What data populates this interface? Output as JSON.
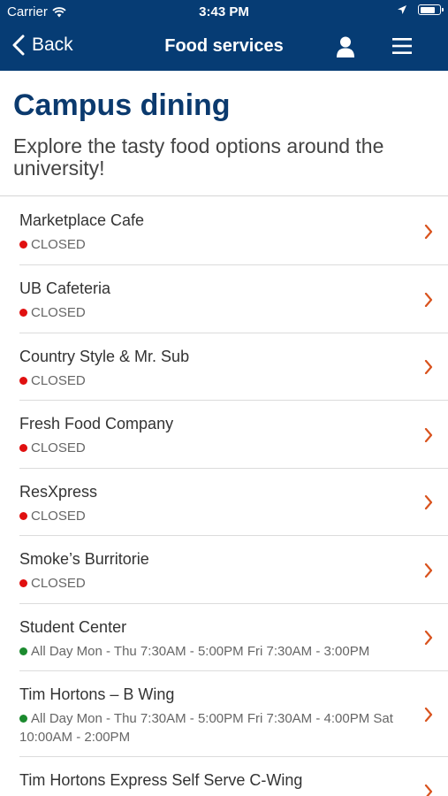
{
  "status_bar": {
    "carrier": "Carrier",
    "time": "3:43 PM"
  },
  "nav": {
    "back_label": "Back",
    "title": "Food services"
  },
  "header": {
    "title": "Campus dining",
    "subtitle": "Explore the tasty food options around the university!"
  },
  "colors": {
    "nav_bg": "#063c74",
    "title": "#0b3a6e",
    "chevron": "#d9531e",
    "closed_dot": "#e01010",
    "open_dot": "#1b8a2e"
  },
  "locations": [
    {
      "name": "Marketplace Cafe",
      "state": "closed",
      "status": "CLOSED"
    },
    {
      "name": "UB Cafeteria",
      "state": "closed",
      "status": "CLOSED"
    },
    {
      "name": "Country Style & Mr. Sub",
      "state": "closed",
      "status": "CLOSED"
    },
    {
      "name": "Fresh Food Company",
      "state": "closed",
      "status": "CLOSED"
    },
    {
      "name": "ResXpress",
      "state": "closed",
      "status": "CLOSED"
    },
    {
      "name": "Smoke’s Burritorie",
      "state": "closed",
      "status": "CLOSED"
    },
    {
      "name": "Student Center",
      "state": "open",
      "status": "All Day Mon - Thu 7:30AM - 5:00PM Fri 7:30AM - 3:00PM"
    },
    {
      "name": "Tim Hortons – B Wing",
      "state": "open",
      "status": "All Day Mon - Thu 7:30AM - 5:00PM Fri 7:30AM - 4:00PM Sat 10:00AM - 2:00PM"
    },
    {
      "name": "Tim Hortons Express Self Serve C-Wing",
      "state": "",
      "status": ""
    }
  ]
}
